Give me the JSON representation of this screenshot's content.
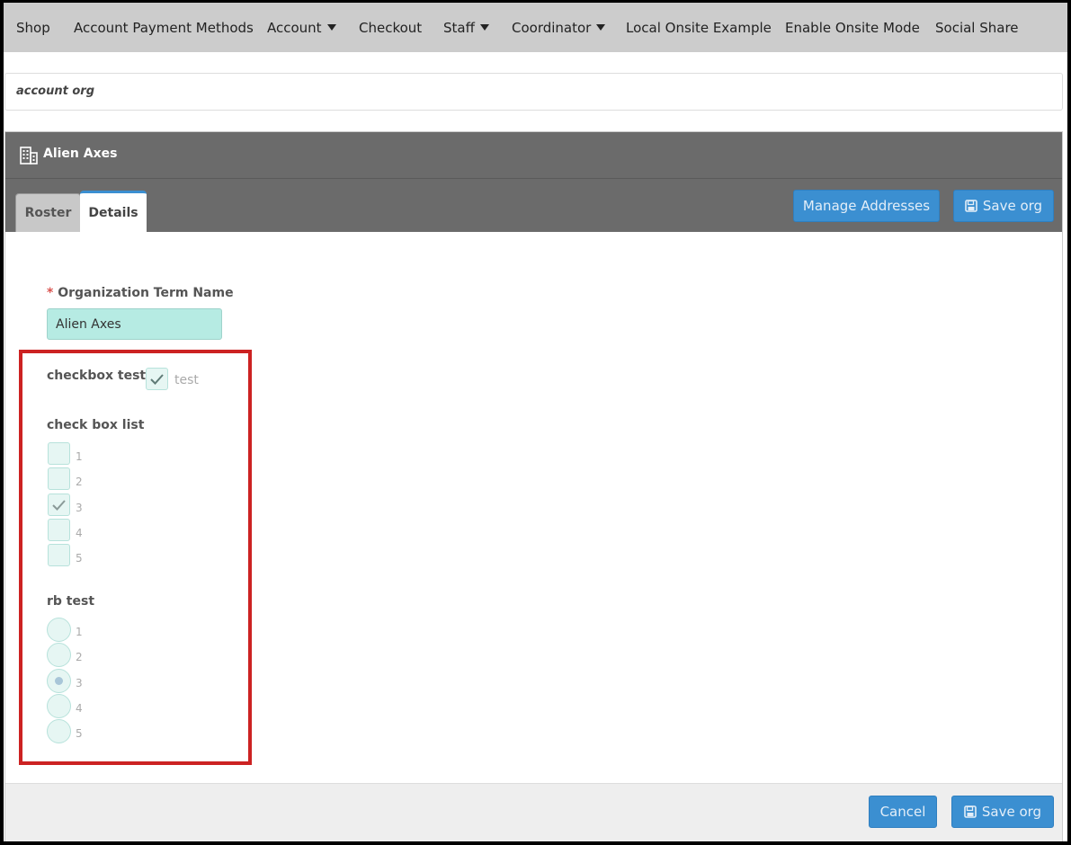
{
  "nav": {
    "items": [
      {
        "label": "Shop",
        "dropdown": false
      },
      {
        "label": "Account Payment Methods",
        "dropdown": false
      },
      {
        "label": "Account",
        "dropdown": true
      },
      {
        "label": "Checkout",
        "dropdown": false
      },
      {
        "label": "Staff",
        "dropdown": true
      },
      {
        "label": "Coordinator",
        "dropdown": true
      },
      {
        "label": "Local Onsite Example",
        "dropdown": false
      },
      {
        "label": "Enable Onsite Mode",
        "dropdown": false
      },
      {
        "label": "Social Share",
        "dropdown": false
      }
    ]
  },
  "account_org": "account org",
  "panel": {
    "title": "Alien Axes",
    "icon": "building-icon",
    "tabs": [
      {
        "label": "Roster",
        "active": false
      },
      {
        "label": "Details",
        "active": true
      }
    ],
    "manage_addresses_label": "Manage Addresses",
    "save_org_label": "Save org"
  },
  "form": {
    "required_mark": "*",
    "org_term_name_label": "Organization Term Name",
    "org_term_name_value": "Alien Axes",
    "checkbox_test": {
      "label": "checkbox test",
      "option": "test",
      "checked": true
    },
    "check_box_list": {
      "label": "check box list",
      "options": [
        {
          "label": "1",
          "checked": false
        },
        {
          "label": "2",
          "checked": false
        },
        {
          "label": "3",
          "checked": true
        },
        {
          "label": "4",
          "checked": false
        },
        {
          "label": "5",
          "checked": false
        }
      ]
    },
    "rb_test": {
      "label": "rb test",
      "options": [
        {
          "label": "1",
          "selected": false
        },
        {
          "label": "2",
          "selected": false
        },
        {
          "label": "3",
          "selected": true
        },
        {
          "label": "4",
          "selected": false
        },
        {
          "label": "5",
          "selected": false
        }
      ]
    }
  },
  "footer": {
    "cancel_label": "Cancel",
    "save_org_label": "Save org"
  },
  "colors": {
    "nav_bg": "#cccccc",
    "panel_header_bg": "#6b6b6b",
    "primary_button": "#3b8fd1",
    "input_bg": "#b6ebe3",
    "highlight_box": "#cc2222"
  }
}
